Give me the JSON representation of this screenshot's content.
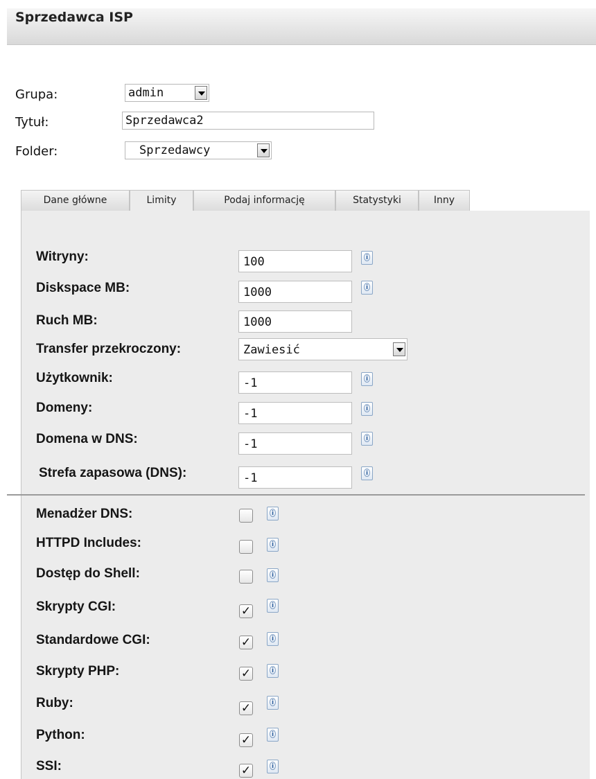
{
  "header": {
    "title": "Sprzedawca ISP"
  },
  "form": {
    "group_label": "Grupa:",
    "group_value": "admin",
    "title_label": "Tytuł:",
    "title_value": "Sprzedawca2",
    "folder_label": "Folder:",
    "folder_value": "Sprzedawcy"
  },
  "tabs": [
    {
      "label": "Dane główne",
      "active": false
    },
    {
      "label": "Limity",
      "active": true
    },
    {
      "label": "Podaj informację",
      "active": false
    },
    {
      "label": "Statystyki",
      "active": false
    },
    {
      "label": "Inny",
      "active": false
    }
  ],
  "limits": {
    "fields": [
      {
        "label": "Witryny:",
        "value": "100",
        "info_icon": true
      },
      {
        "label": "Diskspace MB:",
        "value": "1000",
        "info_icon": true
      },
      {
        "label": "Ruch MB:",
        "value": "1000",
        "info_icon": false
      },
      {
        "label": "Transfer przekroczony:",
        "value": "Zawiesić",
        "type": "select"
      },
      {
        "label": "Użytkownik:",
        "value": "-1",
        "info_icon": true
      },
      {
        "label": "Domeny:",
        "value": "-1",
        "info_icon": true
      },
      {
        "label": "Domena w DNS:",
        "value": "-1",
        "info_icon": true
      },
      {
        "label": "Strefa zapasowa (DNS):",
        "value": "-1",
        "info_icon": true
      }
    ],
    "checkboxes": [
      {
        "label": "Menadżer DNS:",
        "checked": false
      },
      {
        "label": "HTTPD Includes:",
        "checked": false
      },
      {
        "label": "Dostęp do Shell:",
        "checked": false
      },
      {
        "label": "Skrypty CGI:",
        "checked": true
      },
      {
        "label": "Standardowe CGI:",
        "checked": true
      },
      {
        "label": "Skrypty PHP:",
        "checked": true
      },
      {
        "label": "Ruby:",
        "checked": true
      },
      {
        "label": "Python:",
        "checked": true
      },
      {
        "label": "SSI:",
        "checked": true
      }
    ]
  },
  "colors": {
    "panel_bg": "#ececec",
    "header_gradient_top": "#f6f6f6",
    "header_gradient_bottom": "#d9d9d9",
    "info_icon_blue": "#2a5d9c"
  }
}
